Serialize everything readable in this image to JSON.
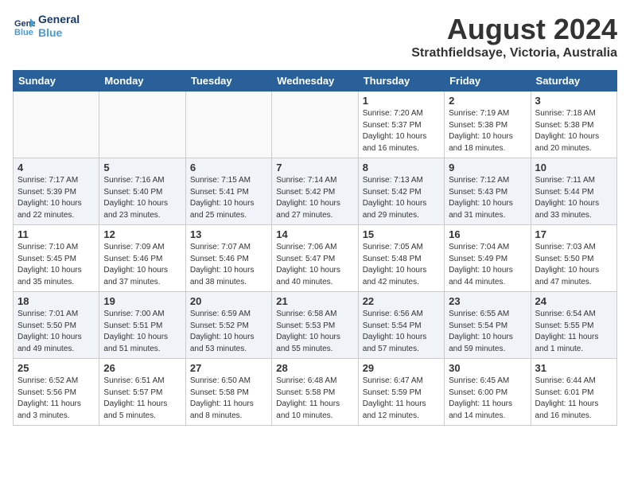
{
  "header": {
    "logo_line1": "General",
    "logo_line2": "Blue",
    "title": "August 2024",
    "subtitle": "Strathfieldsaye, Victoria, Australia"
  },
  "days_of_week": [
    "Sunday",
    "Monday",
    "Tuesday",
    "Wednesday",
    "Thursday",
    "Friday",
    "Saturday"
  ],
  "weeks": [
    [
      {
        "day": "",
        "info": ""
      },
      {
        "day": "",
        "info": ""
      },
      {
        "day": "",
        "info": ""
      },
      {
        "day": "",
        "info": ""
      },
      {
        "day": "1",
        "info": "Sunrise: 7:20 AM\nSunset: 5:37 PM\nDaylight: 10 hours\nand 16 minutes."
      },
      {
        "day": "2",
        "info": "Sunrise: 7:19 AM\nSunset: 5:38 PM\nDaylight: 10 hours\nand 18 minutes."
      },
      {
        "day": "3",
        "info": "Sunrise: 7:18 AM\nSunset: 5:38 PM\nDaylight: 10 hours\nand 20 minutes."
      }
    ],
    [
      {
        "day": "4",
        "info": "Sunrise: 7:17 AM\nSunset: 5:39 PM\nDaylight: 10 hours\nand 22 minutes."
      },
      {
        "day": "5",
        "info": "Sunrise: 7:16 AM\nSunset: 5:40 PM\nDaylight: 10 hours\nand 23 minutes."
      },
      {
        "day": "6",
        "info": "Sunrise: 7:15 AM\nSunset: 5:41 PM\nDaylight: 10 hours\nand 25 minutes."
      },
      {
        "day": "7",
        "info": "Sunrise: 7:14 AM\nSunset: 5:42 PM\nDaylight: 10 hours\nand 27 minutes."
      },
      {
        "day": "8",
        "info": "Sunrise: 7:13 AM\nSunset: 5:42 PM\nDaylight: 10 hours\nand 29 minutes."
      },
      {
        "day": "9",
        "info": "Sunrise: 7:12 AM\nSunset: 5:43 PM\nDaylight: 10 hours\nand 31 minutes."
      },
      {
        "day": "10",
        "info": "Sunrise: 7:11 AM\nSunset: 5:44 PM\nDaylight: 10 hours\nand 33 minutes."
      }
    ],
    [
      {
        "day": "11",
        "info": "Sunrise: 7:10 AM\nSunset: 5:45 PM\nDaylight: 10 hours\nand 35 minutes."
      },
      {
        "day": "12",
        "info": "Sunrise: 7:09 AM\nSunset: 5:46 PM\nDaylight: 10 hours\nand 37 minutes."
      },
      {
        "day": "13",
        "info": "Sunrise: 7:07 AM\nSunset: 5:46 PM\nDaylight: 10 hours\nand 38 minutes."
      },
      {
        "day": "14",
        "info": "Sunrise: 7:06 AM\nSunset: 5:47 PM\nDaylight: 10 hours\nand 40 minutes."
      },
      {
        "day": "15",
        "info": "Sunrise: 7:05 AM\nSunset: 5:48 PM\nDaylight: 10 hours\nand 42 minutes."
      },
      {
        "day": "16",
        "info": "Sunrise: 7:04 AM\nSunset: 5:49 PM\nDaylight: 10 hours\nand 44 minutes."
      },
      {
        "day": "17",
        "info": "Sunrise: 7:03 AM\nSunset: 5:50 PM\nDaylight: 10 hours\nand 47 minutes."
      }
    ],
    [
      {
        "day": "18",
        "info": "Sunrise: 7:01 AM\nSunset: 5:50 PM\nDaylight: 10 hours\nand 49 minutes."
      },
      {
        "day": "19",
        "info": "Sunrise: 7:00 AM\nSunset: 5:51 PM\nDaylight: 10 hours\nand 51 minutes."
      },
      {
        "day": "20",
        "info": "Sunrise: 6:59 AM\nSunset: 5:52 PM\nDaylight: 10 hours\nand 53 minutes."
      },
      {
        "day": "21",
        "info": "Sunrise: 6:58 AM\nSunset: 5:53 PM\nDaylight: 10 hours\nand 55 minutes."
      },
      {
        "day": "22",
        "info": "Sunrise: 6:56 AM\nSunset: 5:54 PM\nDaylight: 10 hours\nand 57 minutes."
      },
      {
        "day": "23",
        "info": "Sunrise: 6:55 AM\nSunset: 5:54 PM\nDaylight: 10 hours\nand 59 minutes."
      },
      {
        "day": "24",
        "info": "Sunrise: 6:54 AM\nSunset: 5:55 PM\nDaylight: 11 hours\nand 1 minute."
      }
    ],
    [
      {
        "day": "25",
        "info": "Sunrise: 6:52 AM\nSunset: 5:56 PM\nDaylight: 11 hours\nand 3 minutes."
      },
      {
        "day": "26",
        "info": "Sunrise: 6:51 AM\nSunset: 5:57 PM\nDaylight: 11 hours\nand 5 minutes."
      },
      {
        "day": "27",
        "info": "Sunrise: 6:50 AM\nSunset: 5:58 PM\nDaylight: 11 hours\nand 8 minutes."
      },
      {
        "day": "28",
        "info": "Sunrise: 6:48 AM\nSunset: 5:58 PM\nDaylight: 11 hours\nand 10 minutes."
      },
      {
        "day": "29",
        "info": "Sunrise: 6:47 AM\nSunset: 5:59 PM\nDaylight: 11 hours\nand 12 minutes."
      },
      {
        "day": "30",
        "info": "Sunrise: 6:45 AM\nSunset: 6:00 PM\nDaylight: 11 hours\nand 14 minutes."
      },
      {
        "day": "31",
        "info": "Sunrise: 6:44 AM\nSunset: 6:01 PM\nDaylight: 11 hours\nand 16 minutes."
      }
    ]
  ]
}
